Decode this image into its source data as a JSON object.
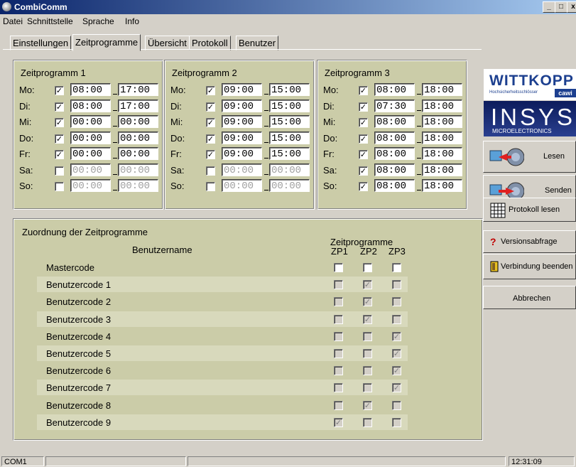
{
  "window": {
    "title": "CombiComm",
    "minimize": "_",
    "maximize": "□",
    "close": "x"
  },
  "menu": [
    "Datei",
    "Schnittstelle",
    "Sprache",
    "Info"
  ],
  "tabs": [
    "Einstellungen",
    "Zeitprogramme",
    "Übersicht",
    "Protokoll",
    "Benutzer"
  ],
  "active_tab": "Zeitprogramme",
  "zeitprogramme": [
    {
      "title": "Zeitprogramm 1",
      "days": [
        {
          "day": "Mo:",
          "checked": true,
          "from": "08:00",
          "to": "17:00"
        },
        {
          "day": "Di:",
          "checked": true,
          "from": "08:00",
          "to": "17:00"
        },
        {
          "day": "Mi:",
          "checked": true,
          "from": "00:00",
          "to": "00:00"
        },
        {
          "day": "Do:",
          "checked": true,
          "from": "00:00",
          "to": "00:00"
        },
        {
          "day": "Fr:",
          "checked": true,
          "from": "00:00",
          "to": "00:00"
        },
        {
          "day": "Sa:",
          "checked": false,
          "from": "00:00",
          "to": "00:00"
        },
        {
          "day": "So:",
          "checked": false,
          "from": "00:00",
          "to": "00:00"
        }
      ]
    },
    {
      "title": "Zeitprogramm 2",
      "days": [
        {
          "day": "Mo:",
          "checked": true,
          "from": "09:00",
          "to": "15:00"
        },
        {
          "day": "Di:",
          "checked": true,
          "from": "09:00",
          "to": "15:00"
        },
        {
          "day": "Mi:",
          "checked": true,
          "from": "09:00",
          "to": "15:00"
        },
        {
          "day": "Do:",
          "checked": true,
          "from": "09:00",
          "to": "15:00"
        },
        {
          "day": "Fr:",
          "checked": true,
          "from": "09:00",
          "to": "15:00"
        },
        {
          "day": "Sa:",
          "checked": false,
          "from": "00:00",
          "to": "00:00"
        },
        {
          "day": "So:",
          "checked": false,
          "from": "00:00",
          "to": "00:00"
        }
      ]
    },
    {
      "title": "Zeitprogramm 3",
      "days": [
        {
          "day": "Mo:",
          "checked": true,
          "from": "08:00",
          "to": "18:00"
        },
        {
          "day": "Di:",
          "checked": true,
          "from": "07:30",
          "to": "18:00"
        },
        {
          "day": "Mi:",
          "checked": true,
          "from": "08:00",
          "to": "18:00"
        },
        {
          "day": "Do:",
          "checked": true,
          "from": "08:00",
          "to": "18:00"
        },
        {
          "day": "Fr:",
          "checked": true,
          "from": "08:00",
          "to": "18:00"
        },
        {
          "day": "Sa:",
          "checked": true,
          "from": "08:00",
          "to": "18:00"
        },
        {
          "day": "So:",
          "checked": true,
          "from": "08:00",
          "to": "18:00"
        }
      ]
    }
  ],
  "zuordnung": {
    "title": "Zuordnung der Zeitprogramme",
    "col_user": "Benutzername",
    "col_group": "Zeitprogramme",
    "cols": [
      "ZP1",
      "ZP2",
      "ZP3"
    ],
    "rows": [
      {
        "name": "Mastercode",
        "zp": [
          false,
          false,
          false
        ],
        "enabled": true
      },
      {
        "name": "Benutzercode 1",
        "zp": [
          false,
          true,
          false
        ],
        "enabled": false
      },
      {
        "name": "Benutzercode 2",
        "zp": [
          false,
          true,
          false
        ],
        "enabled": false
      },
      {
        "name": "Benutzercode 3",
        "zp": [
          false,
          true,
          false
        ],
        "enabled": false
      },
      {
        "name": "Benutzercode 4",
        "zp": [
          false,
          false,
          true
        ],
        "enabled": false
      },
      {
        "name": "Benutzercode 5",
        "zp": [
          false,
          false,
          true
        ],
        "enabled": false
      },
      {
        "name": "Benutzercode 6",
        "zp": [
          false,
          false,
          true
        ],
        "enabled": false
      },
      {
        "name": "Benutzercode 7",
        "zp": [
          false,
          false,
          true
        ],
        "enabled": false
      },
      {
        "name": "Benutzercode 8",
        "zp": [
          false,
          true,
          false
        ],
        "enabled": false
      },
      {
        "name": "Benutzercode 9",
        "zp": [
          true,
          false,
          false
        ],
        "enabled": false
      }
    ]
  },
  "sidebar": {
    "logo_wittkopp": "WITTKOPP",
    "logo_wittkopp_sub": "Hochsicherheitsschlösser",
    "logo_cawi": "cawi",
    "logo_insys": "INSYS",
    "logo_insys_sub": "MICROELECTRONICS",
    "lesen": "Lesen",
    "senden": "Senden",
    "protokoll": "Protokoll lesen",
    "versions": "Versionsabfrage",
    "verbindung": "Verbindung beenden",
    "abbrechen": "Abbrechen"
  },
  "status": {
    "port": "COM1",
    "time": "12:31:09"
  }
}
